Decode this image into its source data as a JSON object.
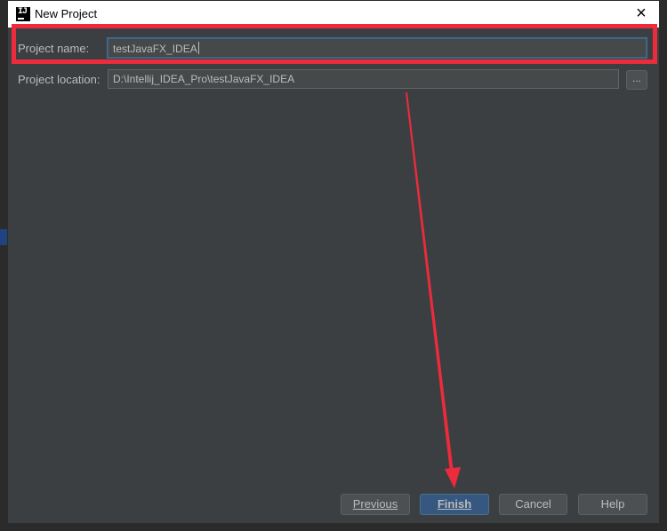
{
  "window": {
    "title": "New Project",
    "close_glyph": "×",
    "app_icon_text": "IJ"
  },
  "form": {
    "project_name_label": "Project name:",
    "project_name_value": "testJavaFX_IDEA",
    "project_location_label": "Project location:",
    "project_location_value": "D:\\Intellij_IDEA_Pro\\testJavaFX_IDEA",
    "browse_label": "..."
  },
  "buttons": {
    "previous": "Previous",
    "finish": "Finish",
    "cancel": "Cancel",
    "help": "Help"
  },
  "annotation": {
    "highlight_color": "#ec2b3c",
    "arrow_color": "#ec2b3c"
  },
  "colors": {
    "dialog_bg": "#3c3f41",
    "field_bg": "#45494a",
    "text": "#bbbbbb",
    "primary_button": "#365880"
  }
}
